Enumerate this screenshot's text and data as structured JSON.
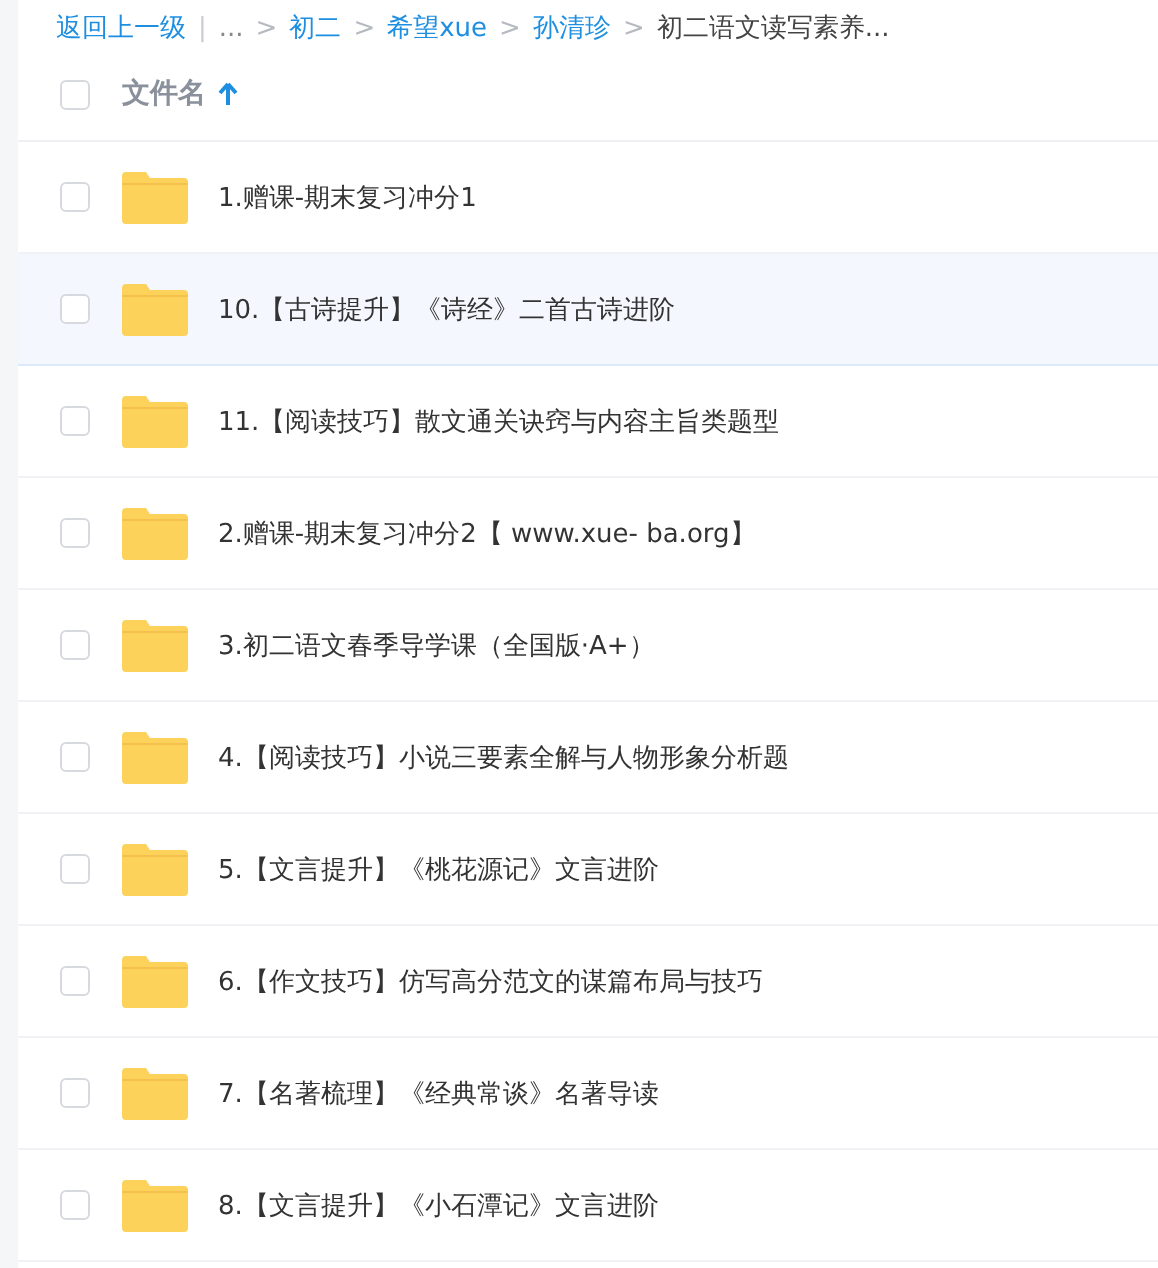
{
  "breadcrumb": [
    {
      "kind": "link",
      "text": "返回上一级"
    },
    {
      "kind": "divider",
      "text": "|"
    },
    {
      "kind": "muted",
      "text": "..."
    },
    {
      "kind": "sep",
      "text": ">"
    },
    {
      "kind": "link",
      "text": "初二"
    },
    {
      "kind": "sep",
      "text": ">"
    },
    {
      "kind": "link",
      "text": "希望xue"
    },
    {
      "kind": "sep",
      "text": ">"
    },
    {
      "kind": "link",
      "text": "孙清珍"
    },
    {
      "kind": "sep",
      "text": ">"
    },
    {
      "kind": "current",
      "text": "初二语文读写素养..."
    }
  ],
  "header": {
    "checked": false,
    "column": "文件名",
    "sorted_ascending": true
  },
  "files": [
    {
      "name": "1.赠课-期末复习冲分1",
      "checked": false,
      "hovered": false
    },
    {
      "name": "10.【古诗提升】《诗经》二首古诗进阶",
      "checked": false,
      "hovered": true
    },
    {
      "name": "11.【阅读技巧】散文通关诀窍与内容主旨类题型",
      "checked": false,
      "hovered": false
    },
    {
      "name": "2.赠课-期末复习冲分2【 www.xue- ba.org】",
      "checked": false,
      "hovered": false
    },
    {
      "name": "3.初二语文春季导学课（全国版·A+）",
      "checked": false,
      "hovered": false
    },
    {
      "name": "4.【阅读技巧】小说三要素全解与人物形象分析题",
      "checked": false,
      "hovered": false
    },
    {
      "name": "5.【文言提升】《桃花源记》文言进阶",
      "checked": false,
      "hovered": false
    },
    {
      "name": "6.【作文技巧】仿写高分范文的谋篇布局与技巧",
      "checked": false,
      "hovered": false
    },
    {
      "name": "7.【名著梳理】《经典常谈》名著导读",
      "checked": false,
      "hovered": false
    },
    {
      "name": "8.【文言提升】《小石潭记》文言进阶",
      "checked": false,
      "hovered": false
    }
  ]
}
